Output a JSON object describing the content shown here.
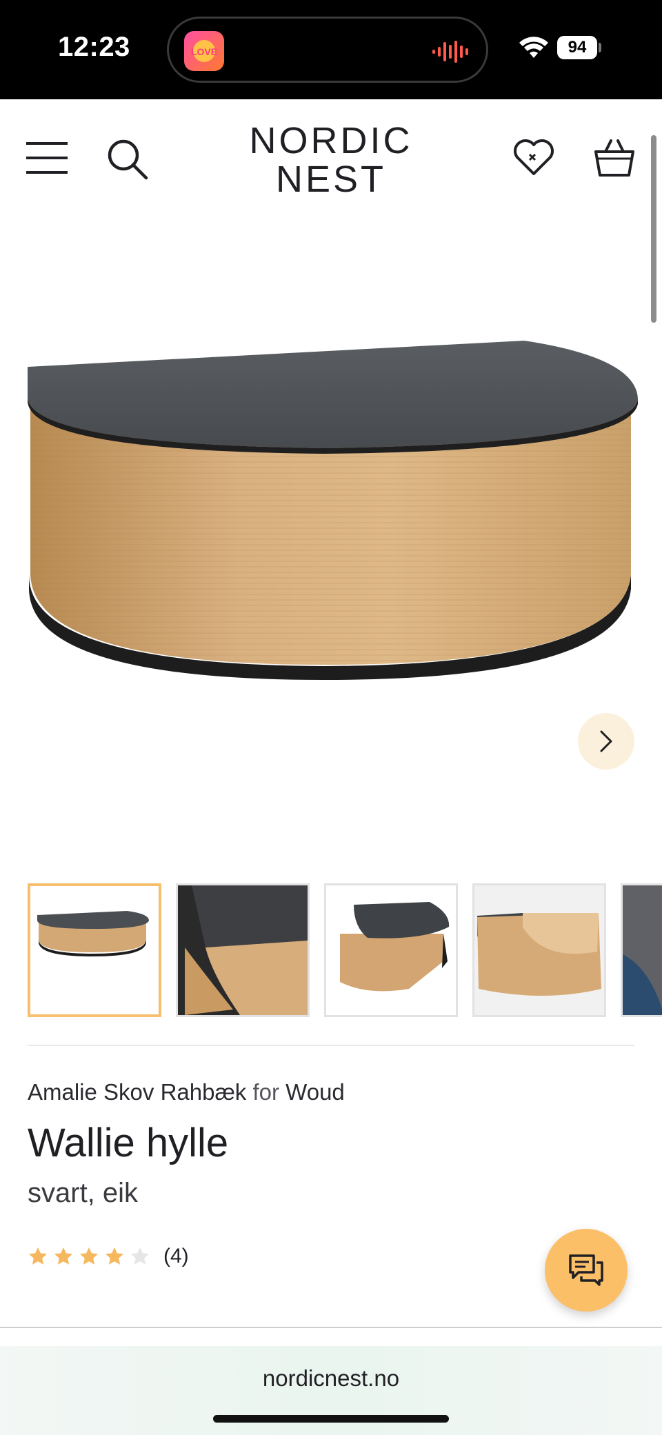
{
  "status_bar": {
    "time": "12:23",
    "battery": "94",
    "island_app_icon": "music-app-icon"
  },
  "header": {
    "logo_line1": "NORDIC",
    "logo_line2": "NEST",
    "icons": [
      "menu-icon",
      "search-icon",
      "wishlist-heart-icon",
      "cart-basket-icon"
    ]
  },
  "gallery": {
    "main_image": "product-image-shelf",
    "next_icon": "chevron-right-icon",
    "thumbnails": [
      {
        "label": "thumbnail-1",
        "active": true
      },
      {
        "label": "thumbnail-2",
        "active": false
      },
      {
        "label": "thumbnail-3",
        "active": false
      },
      {
        "label": "thumbnail-4",
        "active": false
      },
      {
        "label": "thumbnail-5",
        "active": false
      }
    ]
  },
  "product": {
    "designer": "Amalie Skov Rahbæk",
    "for_word": "for",
    "brand": "Woud",
    "title": "Wallie hylle",
    "variant": "svart, eik",
    "rating_value": 4,
    "rating_max": 5,
    "review_count": "(4)"
  },
  "chat": {
    "icon": "chat-bubbles-icon"
  },
  "browser": {
    "url": "nordicnest.no"
  },
  "colors": {
    "accent": "#fbbf67",
    "star_filled": "#f6b85e",
    "star_empty": "#e6e6e6",
    "text": "#1f1f24"
  }
}
